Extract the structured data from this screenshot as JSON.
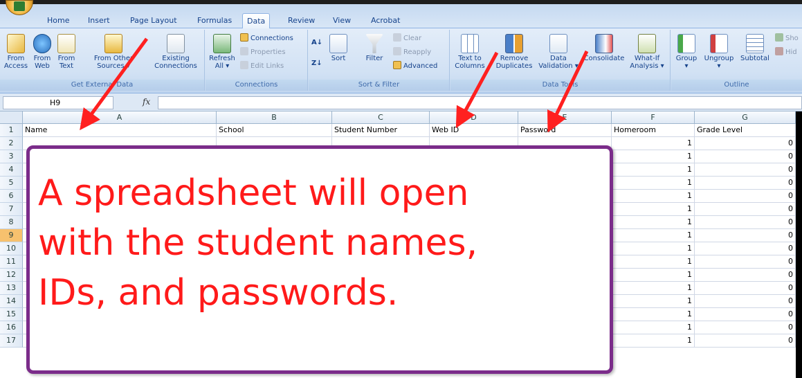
{
  "ribbon": {
    "tabs": [
      {
        "label": "Home"
      },
      {
        "label": "Insert"
      },
      {
        "label": "Page Layout"
      },
      {
        "label": "Formulas"
      },
      {
        "label": "Data",
        "active": true
      },
      {
        "label": "Review"
      },
      {
        "label": "View"
      },
      {
        "label": "Acrobat"
      }
    ],
    "groups": {
      "get_external": {
        "label": "Get External Data",
        "buttons": [
          {
            "label": "From Access"
          },
          {
            "label": "From Web"
          },
          {
            "label": "From Text"
          },
          {
            "label": "From Other Sources ▾"
          },
          {
            "label": "Existing Connections"
          }
        ]
      },
      "connections": {
        "label": "Connections",
        "refresh": "Refresh All ▾",
        "small": [
          "Connections",
          "Properties",
          "Edit Links"
        ]
      },
      "sort_filter": {
        "label": "Sort & Filter",
        "sort": "Sort",
        "filter": "Filter",
        "small": [
          "Clear",
          "Reapply",
          "Advanced"
        ]
      },
      "data_tools": {
        "label": "Data Tools",
        "buttons": [
          {
            "label": "Text to Columns"
          },
          {
            "label": "Remove Duplicates"
          },
          {
            "label": "Data Validation ▾"
          },
          {
            "label": "Consolidate"
          },
          {
            "label": "What-If Analysis ▾"
          }
        ]
      },
      "outline": {
        "label": "Outline",
        "buttons": [
          {
            "label": "Group ▾"
          },
          {
            "label": "Ungroup ▾"
          },
          {
            "label": "Subtotal"
          }
        ],
        "small": [
          "Sho",
          "Hid"
        ]
      }
    }
  },
  "formula_bar": {
    "name_box": "H9",
    "fx": "fx",
    "value": ""
  },
  "sheet": {
    "columns": [
      {
        "letter": "A"
      },
      {
        "letter": "B"
      },
      {
        "letter": "C"
      },
      {
        "letter": "D"
      },
      {
        "letter": "E"
      },
      {
        "letter": "F"
      },
      {
        "letter": "G"
      }
    ],
    "headers": [
      "Name",
      "School",
      "Student Number",
      "Web ID",
      "Password",
      "Homeroom",
      "Grade Level"
    ],
    "rows": [
      "2",
      "3",
      "4",
      "5",
      "6",
      "7",
      "8",
      "9",
      "10",
      "11",
      "12",
      "13",
      "14",
      "15",
      "16",
      "17"
    ],
    "selected_row": "9",
    "homeroom_value": "1",
    "grade_value": "0"
  },
  "callout": {
    "line1": "A spreadsheet will open",
    "line2": "with the student names,",
    "line3": "IDs, and passwords."
  },
  "colors": {
    "callout_text": "#ff1a1a",
    "callout_border": "#7b2c8a",
    "arrow": "#ff2020"
  }
}
